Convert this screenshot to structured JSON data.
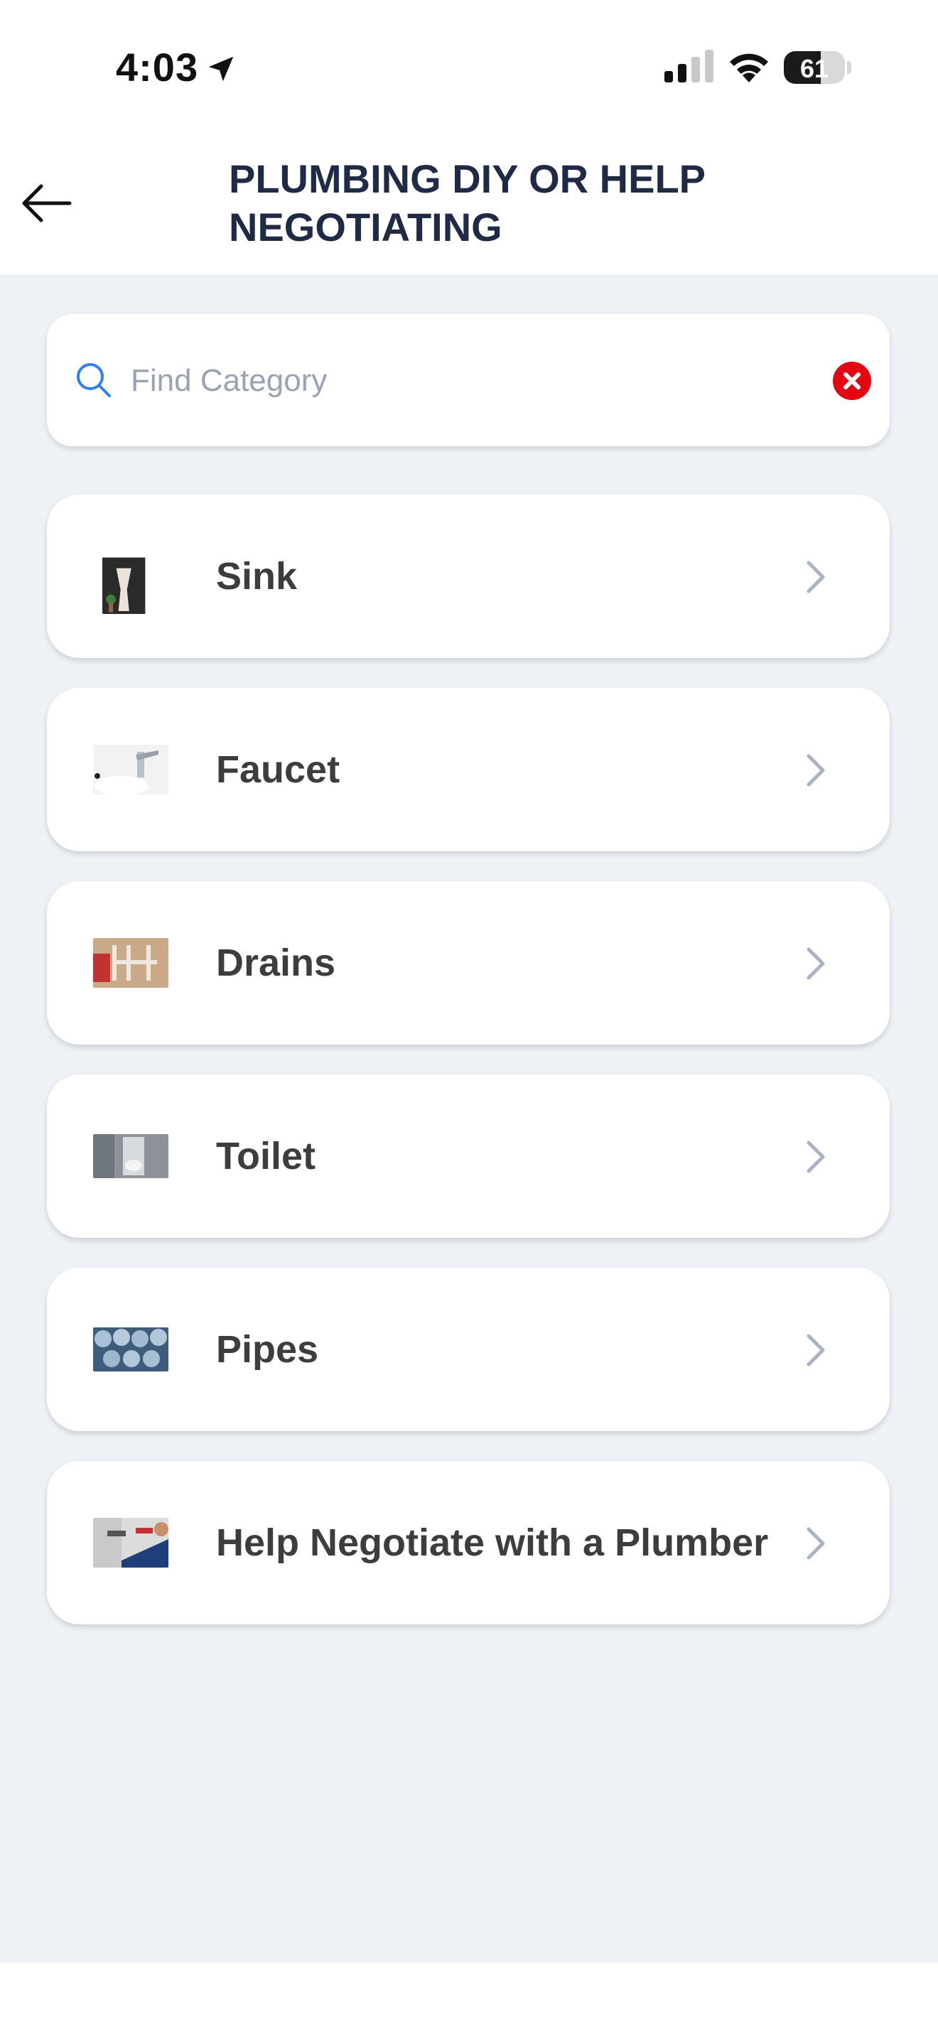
{
  "status_bar": {
    "time": "4:03",
    "battery": "61"
  },
  "header": {
    "title": "PLUMBING DIY OR HELP NEGOTIATING"
  },
  "search": {
    "placeholder": "Find Category",
    "value": ""
  },
  "categories": [
    {
      "label": "Sink",
      "thumbnail": "sink-photo"
    },
    {
      "label": "Faucet",
      "thumbnail": "faucet-photo"
    },
    {
      "label": "Drains",
      "thumbnail": "drains-photo"
    },
    {
      "label": "Toilet",
      "thumbnail": "toilet-photo"
    },
    {
      "label": "Pipes",
      "thumbnail": "pipes-photo"
    },
    {
      "label": "Help Negotiate with a Plumber",
      "thumbnail": "plumber-photo"
    }
  ],
  "colors": {
    "title": "#1f2a44",
    "search_icon": "#2f80ed",
    "clear_icon": "#e30613",
    "background": "#eef1f6",
    "chevron": "#aab3c5"
  }
}
